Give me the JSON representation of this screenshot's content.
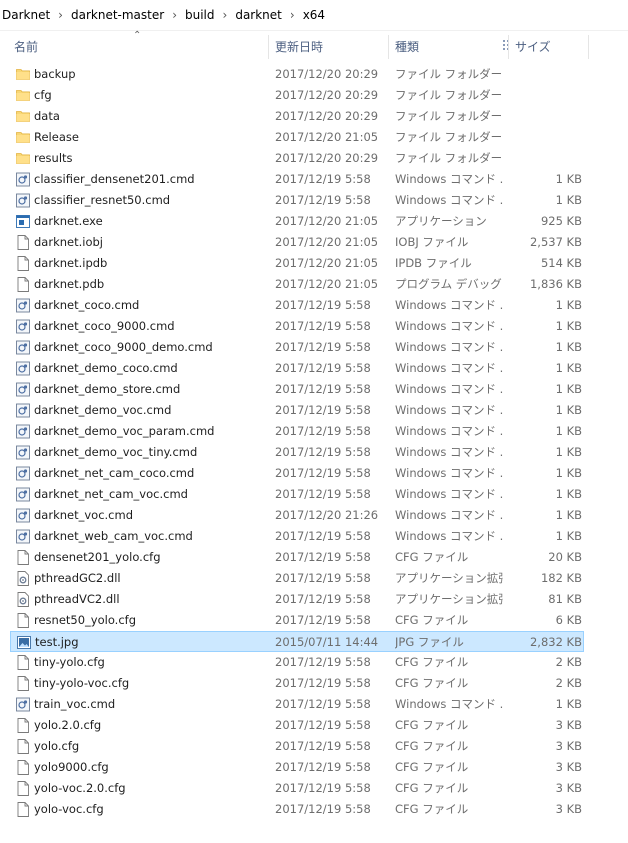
{
  "breadcrumb": [
    "Darknet",
    "darknet-master",
    "build",
    "darknet",
    "x64"
  ],
  "columns": {
    "name": "名前",
    "date": "更新日時",
    "type": "種類",
    "size": "サイズ"
  },
  "files": [
    {
      "name": "backup",
      "date": "2017/12/20 20:29",
      "type": "ファイル フォルダー",
      "size": "",
      "icon": "folder-icon"
    },
    {
      "name": "cfg",
      "date": "2017/12/20 20:29",
      "type": "ファイル フォルダー",
      "size": "",
      "icon": "folder-icon"
    },
    {
      "name": "data",
      "date": "2017/12/20 20:29",
      "type": "ファイル フォルダー",
      "size": "",
      "icon": "folder-icon"
    },
    {
      "name": "Release",
      "date": "2017/12/20 21:05",
      "type": "ファイル フォルダー",
      "size": "",
      "icon": "folder-icon"
    },
    {
      "name": "results",
      "date": "2017/12/20 20:29",
      "type": "ファイル フォルダー",
      "size": "",
      "icon": "folder-icon"
    },
    {
      "name": "classifier_densenet201.cmd",
      "date": "2017/12/19 5:58",
      "type": "Windows コマンド ...",
      "size": "1 KB",
      "icon": "cmd-file-icon"
    },
    {
      "name": "classifier_resnet50.cmd",
      "date": "2017/12/19 5:58",
      "type": "Windows コマンド ...",
      "size": "1 KB",
      "icon": "cmd-file-icon"
    },
    {
      "name": "darknet.exe",
      "date": "2017/12/20 21:05",
      "type": "アプリケーション",
      "size": "925 KB",
      "icon": "exe-file-icon"
    },
    {
      "name": "darknet.iobj",
      "date": "2017/12/20 21:05",
      "type": "IOBJ ファイル",
      "size": "2,537 KB",
      "icon": "file-icon"
    },
    {
      "name": "darknet.ipdb",
      "date": "2017/12/20 21:05",
      "type": "IPDB ファイル",
      "size": "514 KB",
      "icon": "file-icon"
    },
    {
      "name": "darknet.pdb",
      "date": "2017/12/20 21:05",
      "type": "プログラム デバッグ デ...",
      "size": "1,836 KB",
      "icon": "file-icon"
    },
    {
      "name": "darknet_coco.cmd",
      "date": "2017/12/19 5:58",
      "type": "Windows コマンド ...",
      "size": "1 KB",
      "icon": "cmd-file-icon"
    },
    {
      "name": "darknet_coco_9000.cmd",
      "date": "2017/12/19 5:58",
      "type": "Windows コマンド ...",
      "size": "1 KB",
      "icon": "cmd-file-icon"
    },
    {
      "name": "darknet_coco_9000_demo.cmd",
      "date": "2017/12/19 5:58",
      "type": "Windows コマンド ...",
      "size": "1 KB",
      "icon": "cmd-file-icon"
    },
    {
      "name": "darknet_demo_coco.cmd",
      "date": "2017/12/19 5:58",
      "type": "Windows コマンド ...",
      "size": "1 KB",
      "icon": "cmd-file-icon"
    },
    {
      "name": "darknet_demo_store.cmd",
      "date": "2017/12/19 5:58",
      "type": "Windows コマンド ...",
      "size": "1 KB",
      "icon": "cmd-file-icon"
    },
    {
      "name": "darknet_demo_voc.cmd",
      "date": "2017/12/19 5:58",
      "type": "Windows コマンド ...",
      "size": "1 KB",
      "icon": "cmd-file-icon"
    },
    {
      "name": "darknet_demo_voc_param.cmd",
      "date": "2017/12/19 5:58",
      "type": "Windows コマンド ...",
      "size": "1 KB",
      "icon": "cmd-file-icon"
    },
    {
      "name": "darknet_demo_voc_tiny.cmd",
      "date": "2017/12/19 5:58",
      "type": "Windows コマンド ...",
      "size": "1 KB",
      "icon": "cmd-file-icon"
    },
    {
      "name": "darknet_net_cam_coco.cmd",
      "date": "2017/12/19 5:58",
      "type": "Windows コマンド ...",
      "size": "1 KB",
      "icon": "cmd-file-icon"
    },
    {
      "name": "darknet_net_cam_voc.cmd",
      "date": "2017/12/19 5:58",
      "type": "Windows コマンド ...",
      "size": "1 KB",
      "icon": "cmd-file-icon"
    },
    {
      "name": "darknet_voc.cmd",
      "date": "2017/12/20 21:26",
      "type": "Windows コマンド ...",
      "size": "1 KB",
      "icon": "cmd-file-icon"
    },
    {
      "name": "darknet_web_cam_voc.cmd",
      "date": "2017/12/19 5:58",
      "type": "Windows コマンド ...",
      "size": "1 KB",
      "icon": "cmd-file-icon"
    },
    {
      "name": "densenet201_yolo.cfg",
      "date": "2017/12/19 5:58",
      "type": "CFG ファイル",
      "size": "20 KB",
      "icon": "file-icon"
    },
    {
      "name": "pthreadGC2.dll",
      "date": "2017/12/19 5:58",
      "type": "アプリケーション拡張",
      "size": "182 KB",
      "icon": "dll-file-icon"
    },
    {
      "name": "pthreadVC2.dll",
      "date": "2017/12/19 5:58",
      "type": "アプリケーション拡張",
      "size": "81 KB",
      "icon": "dll-file-icon"
    },
    {
      "name": "resnet50_yolo.cfg",
      "date": "2017/12/19 5:58",
      "type": "CFG ファイル",
      "size": "6 KB",
      "icon": "file-icon"
    },
    {
      "name": "test.jpg",
      "date": "2015/07/11 14:44",
      "type": "JPG ファイル",
      "size": "2,832 KB",
      "icon": "image-file-icon",
      "selected": true
    },
    {
      "name": "tiny-yolo.cfg",
      "date": "2017/12/19 5:58",
      "type": "CFG ファイル",
      "size": "2 KB",
      "icon": "file-icon"
    },
    {
      "name": "tiny-yolo-voc.cfg",
      "date": "2017/12/19 5:58",
      "type": "CFG ファイル",
      "size": "2 KB",
      "icon": "file-icon"
    },
    {
      "name": "train_voc.cmd",
      "date": "2017/12/19 5:58",
      "type": "Windows コマンド ...",
      "size": "1 KB",
      "icon": "cmd-file-icon"
    },
    {
      "name": "yolo.2.0.cfg",
      "date": "2017/12/19 5:58",
      "type": "CFG ファイル",
      "size": "3 KB",
      "icon": "file-icon"
    },
    {
      "name": "yolo.cfg",
      "date": "2017/12/19 5:58",
      "type": "CFG ファイル",
      "size": "3 KB",
      "icon": "file-icon"
    },
    {
      "name": "yolo9000.cfg",
      "date": "2017/12/19 5:58",
      "type": "CFG ファイル",
      "size": "3 KB",
      "icon": "file-icon"
    },
    {
      "name": "yolo-voc.2.0.cfg",
      "date": "2017/12/19 5:58",
      "type": "CFG ファイル",
      "size": "3 KB",
      "icon": "file-icon"
    },
    {
      "name": "yolo-voc.cfg",
      "date": "2017/12/19 5:58",
      "type": "CFG ファイル",
      "size": "3 KB",
      "icon": "file-icon"
    }
  ],
  "colors": {
    "selection_bg": "#cce8ff",
    "selection_border": "#99d1ff",
    "header_text": "#4d6082",
    "folder": "#f8d775",
    "muted_text": "#6d6d6d"
  }
}
